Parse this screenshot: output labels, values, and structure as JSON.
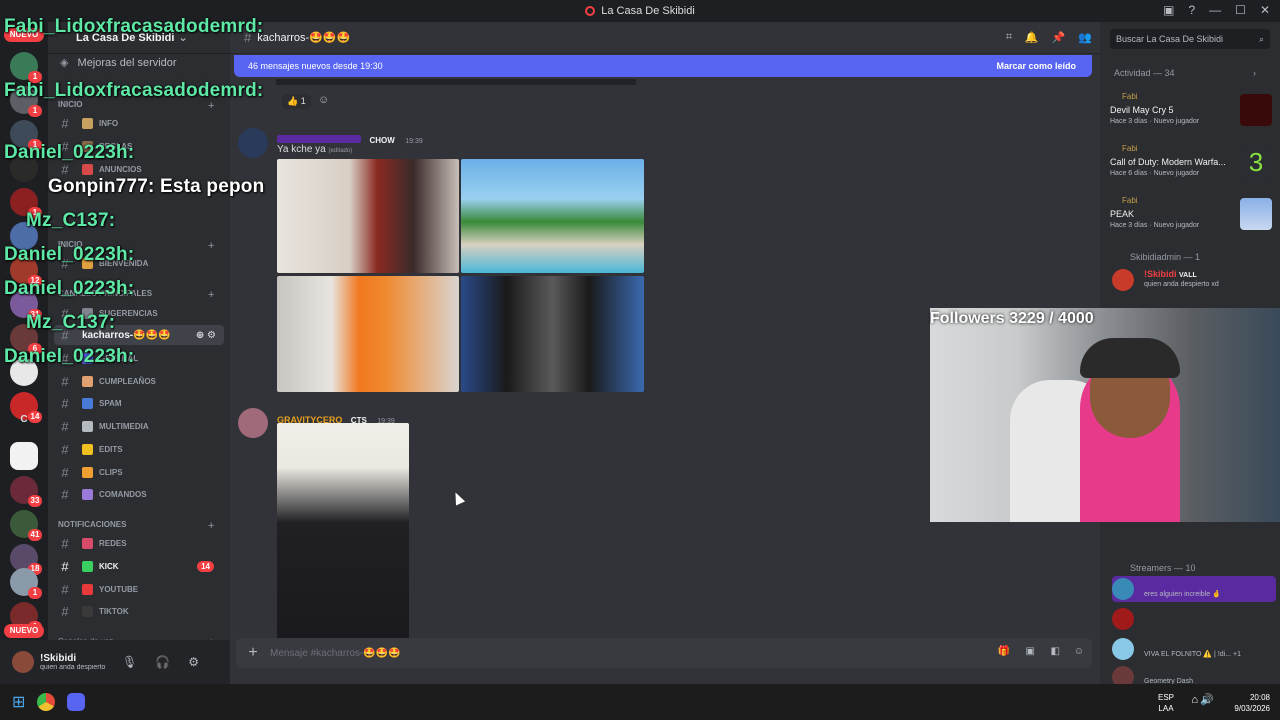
{
  "window": {
    "title": "La Casa De Skibidi"
  },
  "servers": {
    "nuevo_label": "NUEVO",
    "letter": "C",
    "badges": [
      "1",
      "1",
      "1",
      "1",
      "12",
      "31",
      "6",
      "14",
      "33",
      "41",
      "18",
      "1",
      "1"
    ]
  },
  "guild": {
    "name": "La Casa De Skibidi",
    "boost": "Mejoras del servidor",
    "categories": [
      "INICIO",
      "INICIO",
      "CANALES PRINCIPALES",
      "NOTIFICACIONES",
      "Canales de voz"
    ],
    "channels": [
      {
        "name": "INFO"
      },
      {
        "name": "REGLAS"
      },
      {
        "name": "ANUNCIOS"
      },
      {
        "name": "BIENVENIDA"
      },
      {
        "name": "SUGERENCIAS"
      },
      {
        "name": "kacharros-🤩🤩🤩"
      },
      {
        "name": "GENERAL"
      },
      {
        "name": "CUMPLEAÑOS"
      },
      {
        "name": "SPAM"
      },
      {
        "name": "MULTIMEDIA"
      },
      {
        "name": "EDITS"
      },
      {
        "name": "CLIPS"
      },
      {
        "name": "COMANDOS"
      },
      {
        "name": "REDES"
      },
      {
        "name": "KICK",
        "badge": "14"
      },
      {
        "name": "YOUTUBE"
      },
      {
        "name": "TIKTOK"
      }
    ]
  },
  "user": {
    "name": "!Skibidi",
    "status": "quien anda despierto"
  },
  "channel": {
    "name": "kacharros-🤩🤩🤩",
    "composer_placeholder": "Mensaje #kacharros-🤩🤩🤩"
  },
  "banner": {
    "text": "46 mensajes nuevos desde 19:30",
    "action": "Marcar como leído"
  },
  "reactions": {
    "count": "1"
  },
  "messages": [
    {
      "tag": "CHOW",
      "time": "19:39",
      "text": "Ya kche ya",
      "edited": "(editado)"
    },
    {
      "user": "GRAVITYCERO",
      "tag": "CTS",
      "time": "19:39"
    }
  ],
  "members": {
    "search": "Buscar La Casa De Skibidi",
    "activity_title": "Actividad — 34",
    "activities": [
      {
        "who": "Fabi",
        "game": "Devil May Cry 5",
        "meta": "Hace 3 días",
        "badge": "Nuevo jugador"
      },
      {
        "who": "Fabi",
        "game": "Call of Duty: Modern Warfa...",
        "meta": "Hace 6 días",
        "badge": "Nuevo jugador"
      },
      {
        "who": "Fabi",
        "game": "PEAK",
        "meta": "Hace 3 días",
        "badge": "Nuevo jugador"
      }
    ],
    "section_admin": "Skibidiadmin — 1",
    "admin": {
      "name": "!Skibidi",
      "tag": "VALL",
      "status": "quien anda despierto xd"
    },
    "section_streamers": "Streamers — 10",
    "streamers": [
      {
        "name": "",
        "status": "eres alguien increible 🤞"
      },
      {
        "name": "",
        "status": ""
      },
      {
        "name": "",
        "status": "VIVA EL FOLNITO ⚠️ | !di... +1"
      },
      {
        "name": "",
        "status": "Geometry Dash"
      }
    ]
  },
  "stream": {
    "followers": "Followers 3229 / 4000",
    "chat": [
      {
        "text": "Fabi_Lidoxfracasadodemrd:",
        "white": false
      },
      {
        "text": "Fabi_Lidoxfracasadodemrd:",
        "white": false
      },
      {
        "text": "Daniel_0223h:",
        "white": false
      },
      {
        "text": "Gonpin777: Esta pepon",
        "white": true
      },
      {
        "text": "Mz_C137:",
        "white": false
      },
      {
        "text": "Daniel_0223h:",
        "white": false
      },
      {
        "text": "Daniel_0223h:",
        "white": false
      },
      {
        "text": "Mz_C137:",
        "white": false
      },
      {
        "text": "Daniel_0223h:",
        "white": false
      }
    ]
  },
  "taskbar": {
    "lang1": "ESP",
    "lang2": "LAA",
    "time": "20:08",
    "date": "9/03/2026"
  }
}
